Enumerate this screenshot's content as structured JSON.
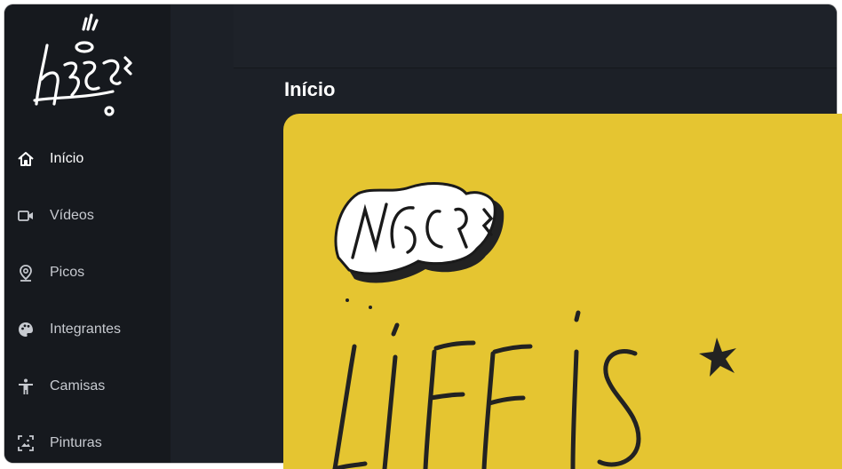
{
  "app": {
    "logo": "NCG graffiti logo",
    "accent": "#e5c531",
    "sidebar_bg": "#16191e"
  },
  "sidebar": {
    "items": [
      {
        "label": "Início",
        "icon": "home-icon",
        "active": true
      },
      {
        "label": "Vídeos",
        "icon": "video-camera-icon",
        "active": false
      },
      {
        "label": "Picos",
        "icon": "location-pin-icon",
        "active": false
      },
      {
        "label": "Integrantes",
        "icon": "palette-icon",
        "active": false
      },
      {
        "label": "Camisas",
        "icon": "person-icon",
        "active": false
      },
      {
        "label": "Pinturas",
        "icon": "image-frame-icon",
        "active": false
      }
    ]
  },
  "main": {
    "title": "Início",
    "banner": {
      "graffiti_text": "NCG",
      "handwritten_text": "LIFE IS"
    }
  }
}
